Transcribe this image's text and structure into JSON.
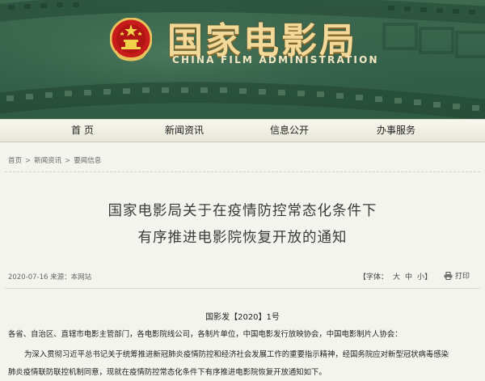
{
  "site": {
    "title_cn": "国家电影局",
    "title_en": "CHINA FILM ADMINISTRATION",
    "brand_color": "#34604a",
    "accent_color": "#f2d99a"
  },
  "nav": {
    "items": [
      {
        "label": "首 页"
      },
      {
        "label": "新闻资讯"
      },
      {
        "label": "信息公开"
      },
      {
        "label": "办事服务"
      }
    ]
  },
  "breadcrumb": {
    "items": [
      "首页",
      "新闻资讯",
      "要闻信息"
    ],
    "separator": ">"
  },
  "article": {
    "title_line1": "国家电影局关于在疫情防控常态化条件下",
    "title_line2": "有序推进电影院恢复开放的通知",
    "meta": "2020-07-16 来源：本网站",
    "font_size_label": "【字体：",
    "font_size_options": [
      "大",
      "中",
      "小"
    ],
    "font_size_close": "】",
    "print_label": "打印",
    "doc_number": "国影发【2020】1号",
    "para1": "各省、自治区、直辖市电影主管部门，各电影院线公司，各制片单位，中国电影发行放映协会，中国电影制片人协会：",
    "para2": "为深入贯彻习近平总书记关于统筹推进新冠肺炎疫情防控和经济社会发展工作的重要指示精神，经国务院应对新型冠状病毒感染",
    "para3": "肺炎疫情联防联控机制同意，现就在疫情防控常态化条件下有序推进电影院恢复开放通知如下。"
  }
}
